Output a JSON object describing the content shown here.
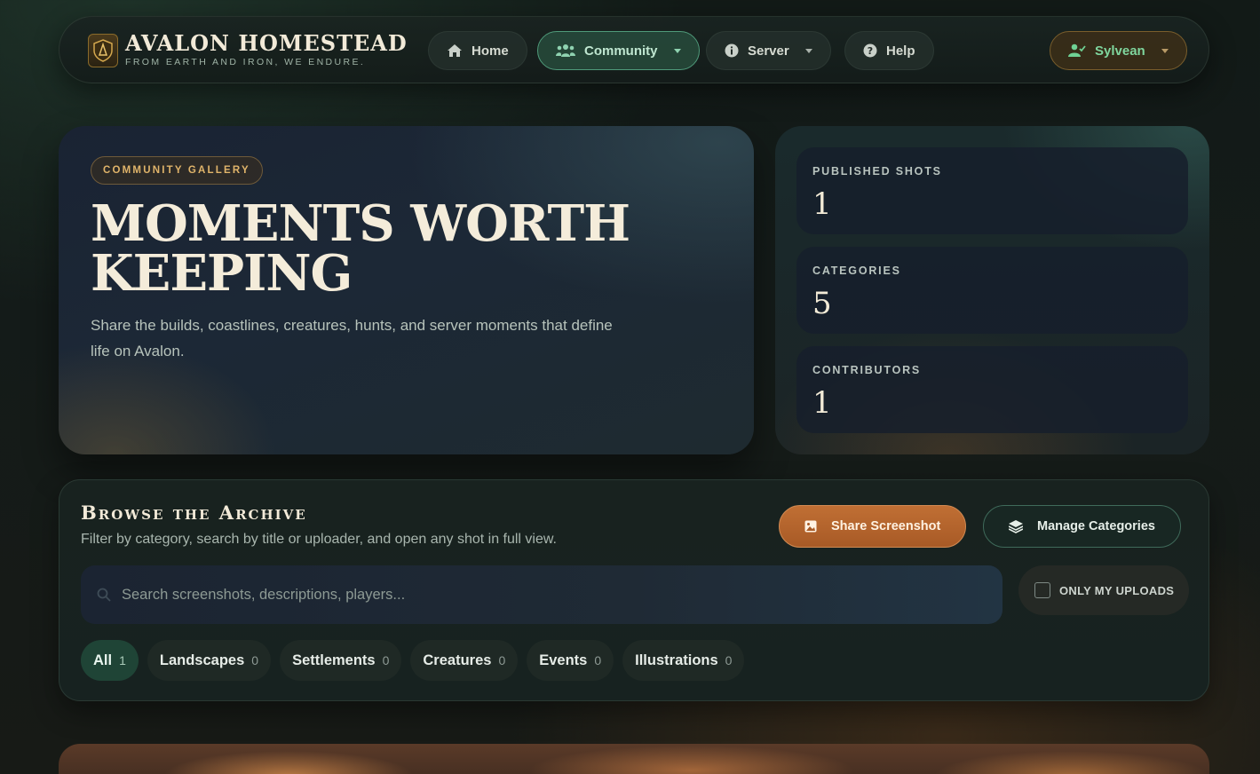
{
  "brand": {
    "title": "AVALON HOMESTEAD",
    "subtitle": "FROM EARTH AND IRON, WE ENDURE.",
    "logo_icon": "shield-crest-icon"
  },
  "nav": {
    "home": "Home",
    "community": "Community",
    "server": "Server",
    "help": "Help",
    "user": "Sylvean",
    "active": "Community"
  },
  "hero": {
    "tag": "COMMUNITY GALLERY",
    "title": "MOMENTS WORTH KEEPING",
    "description": "Share the builds, coastlines, creatures, hunts, and server moments that define life on Avalon."
  },
  "stats": [
    {
      "label": "PUBLISHED SHOTS",
      "value": "1"
    },
    {
      "label": "CATEGORIES",
      "value": "5"
    },
    {
      "label": "CONTRIBUTORS",
      "value": "1"
    }
  ],
  "browse": {
    "title": "Browse the Archive",
    "description": "Filter by category, search by title or uploader, and open any shot in full view.",
    "share_label": "Share Screenshot",
    "manage_label": "Manage Categories",
    "search_placeholder": "Search screenshots, descriptions, players...",
    "search_value": "",
    "only_mine_label": "ONLY MY UPLOADS",
    "only_mine_checked": false,
    "categories": [
      {
        "label": "All",
        "count": "1",
        "active": true
      },
      {
        "label": "Landscapes",
        "count": "0"
      },
      {
        "label": "Settlements",
        "count": "0"
      },
      {
        "label": "Creatures",
        "count": "0"
      },
      {
        "label": "Events",
        "count": "0"
      },
      {
        "label": "Illustrations",
        "count": "0"
      }
    ]
  },
  "colors": {
    "accent_green": "#4f9a7a",
    "accent_copper": "#b3652d",
    "gold": "#e0b46a",
    "background": "#141b19"
  }
}
